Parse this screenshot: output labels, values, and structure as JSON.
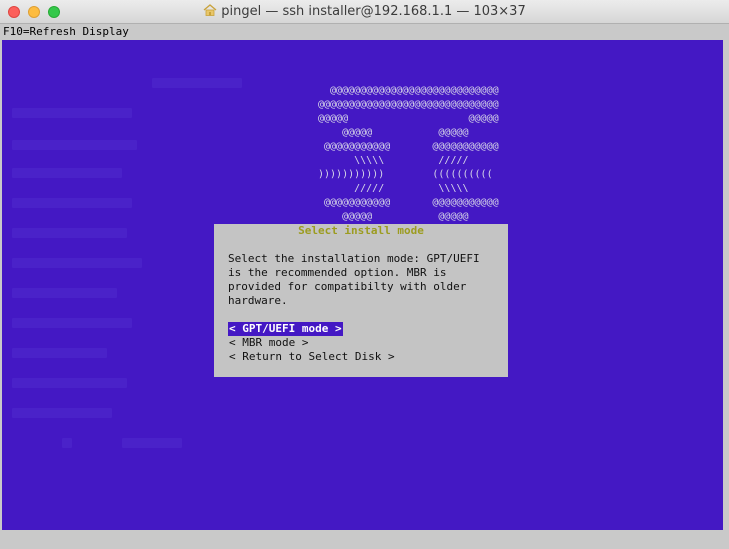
{
  "window": {
    "title": "pingel — ssh installer@192.168.1.1 — 103×37"
  },
  "terminal": {
    "topbar": "F10=Refresh Display",
    "logo_lines": [
      "  @@@@@@@@@@@@@@@@@@@@@@@@@@@@",
      "@@@@@@@@@@@@@@@@@@@@@@@@@@@@@@",
      "@@@@@                    @@@@@",
      "    @@@@@           @@@@@",
      " @@@@@@@@@@@       @@@@@@@@@@@",
      "      \\\\\\\\\\         /////",
      ")))))))))))        ((((((((((",
      "      /////         \\\\\\\\\\",
      " @@@@@@@@@@@       @@@@@@@@@@@",
      "    @@@@@           @@@@@",
      "@@@@@                    @@@@@",
      "@@@@@@@@@@@@@@@@@@@@@@@@@@@@@@",
      "  @@@@@@@@@@@@@@@@@@@@@@@@@@@@"
    ],
    "dialog": {
      "title": "Select install mode",
      "text": "Select the installation mode: GPT/UEFI\nis the recommended option. MBR is\nprovided for compatibilty with older\nhardware.",
      "options": [
        "< GPT/UEFI mode >",
        "< MBR mode >",
        "< Return to Select Disk >"
      ]
    }
  },
  "colors": {
    "background_blue": "#4418c4",
    "dialog_gray": "#c4c4c4",
    "title_olive": "#9c9c20"
  }
}
